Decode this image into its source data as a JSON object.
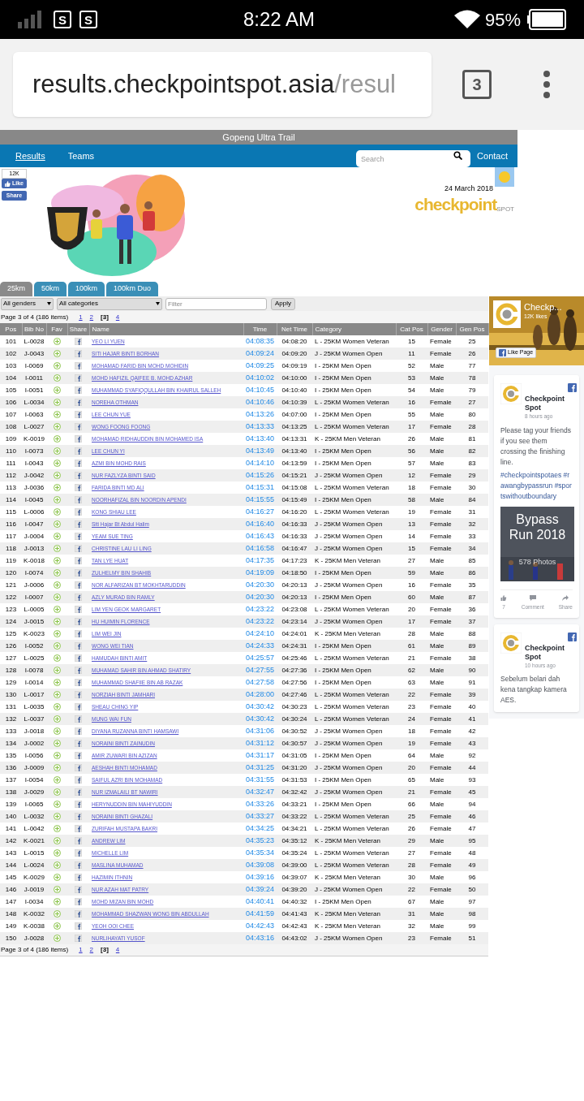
{
  "status_bar": {
    "notifications": [
      "S",
      "S"
    ],
    "time": "8:22 AM",
    "battery": "95%"
  },
  "browser": {
    "url_host": "results.checkpointspot.asia",
    "url_path": "/resul",
    "tab_count": "3"
  },
  "site": {
    "title": "Gopeng Ultra Trail",
    "nav": [
      {
        "label": "Results",
        "selected": true
      },
      {
        "label": "Teams",
        "selected": false
      }
    ],
    "search_placeholder": "Search",
    "contact": "Contact"
  },
  "header": {
    "like_count": "12K",
    "like": "Like",
    "share": "Share",
    "date": "24 March 2018",
    "logo": "checkpoint",
    "logo_sub": "SPOT"
  },
  "distance_tabs": [
    {
      "label": "25km",
      "selected": true
    },
    {
      "label": "50km",
      "selected": false
    },
    {
      "label": "100km",
      "selected": false
    },
    {
      "label": "100km Duo",
      "selected": false
    }
  ],
  "filters": {
    "gender": "All genders",
    "category": "All categories",
    "filter_placeholder": "Filter",
    "apply": "Apply"
  },
  "pager_top": {
    "summary": "Page 3 of 4 (186 items)",
    "pages": [
      {
        "label": "1",
        "selected": false
      },
      {
        "label": "2",
        "selected": false
      },
      {
        "label": "[3]",
        "selected": true
      },
      {
        "label": "4",
        "selected": false
      }
    ]
  },
  "table": {
    "columns": [
      "Pos",
      "Bib No",
      "Fav",
      "Share",
      "Name",
      "Time",
      "Net Time",
      "Category",
      "Cat Pos",
      "Gender",
      "Gen Pos"
    ],
    "rows": [
      [
        "101",
        "L-0028",
        "",
        "",
        "YEO LI YUEN",
        "04:08:35",
        "04:08:20",
        "L - 25KM Women Veteran",
        "15",
        "Female",
        "25"
      ],
      [
        "102",
        "J-0043",
        "",
        "",
        "SITI HAJAR BINTI BORHAN",
        "04:09:24",
        "04:09:20",
        "J - 25KM Women Open",
        "11",
        "Female",
        "26"
      ],
      [
        "103",
        "I-0069",
        "",
        "",
        "MOHAMAD FARID BIN MOHD MOHIDIN",
        "04:09:25",
        "04:09:19",
        "I - 25KM Men Open",
        "52",
        "Male",
        "77"
      ],
      [
        "104",
        "I-0011",
        "",
        "",
        "MOHD HAFIZIL QAIFEE B. MOHD AZHAR",
        "04:10:02",
        "04:10:00",
        "I - 25KM Men Open",
        "53",
        "Male",
        "78"
      ],
      [
        "105",
        "I-0051",
        "",
        "",
        "MUHAMMAD SYAFIQQULLAH BIN KHAIRUL SALLEH",
        "04:10:45",
        "04:10:40",
        "I - 25KM Men Open",
        "54",
        "Male",
        "79"
      ],
      [
        "106",
        "L-0034",
        "",
        "",
        "NOREHA OTHMAN",
        "04:10:46",
        "04:10:39",
        "L - 25KM Women Veteran",
        "16",
        "Female",
        "27"
      ],
      [
        "107",
        "I-0063",
        "",
        "",
        "LEE CHUN YUE",
        "04:13:26",
        "04:07:00",
        "I - 25KM Men Open",
        "55",
        "Male",
        "80"
      ],
      [
        "108",
        "L-0027",
        "",
        "",
        "WONG FOONG FOONG",
        "04:13:33",
        "04:13:25",
        "L - 25KM Women Veteran",
        "17",
        "Female",
        "28"
      ],
      [
        "109",
        "K-0019",
        "",
        "",
        "MOHAMAD RIDHAUDDIN BIN MOHAMED ISA",
        "04:13:40",
        "04:13:31",
        "K - 25KM Men Veteran",
        "26",
        "Male",
        "81"
      ],
      [
        "110",
        "I-0073",
        "",
        "",
        "LEE CHUN YI",
        "04:13:49",
        "04:13:40",
        "I - 25KM Men Open",
        "56",
        "Male",
        "82"
      ],
      [
        "111",
        "I-0043",
        "",
        "",
        "AZMI BIN MOHD RAIS",
        "04:14:10",
        "04:13:59",
        "I - 25KM Men Open",
        "57",
        "Male",
        "83"
      ],
      [
        "112",
        "J-0042",
        "",
        "",
        "NUR FAZLYZA BINTI SAID",
        "04:15:26",
        "04:15:21",
        "J - 25KM Women Open",
        "12",
        "Female",
        "29"
      ],
      [
        "113",
        "J-0036",
        "",
        "",
        "FARIDA BINTI MD ALI",
        "04:15:31",
        "04:15:08",
        "L - 25KM Women Veteran",
        "18",
        "Female",
        "30"
      ],
      [
        "114",
        "I-0045",
        "",
        "",
        "NOORHAFIZAL BIN NOORDIN APENDI",
        "04:15:55",
        "04:15:49",
        "I - 25KM Men Open",
        "58",
        "Male",
        "84"
      ],
      [
        "115",
        "L-0006",
        "",
        "",
        "KONG SHIAU LEE",
        "04:16:27",
        "04:16:20",
        "L - 25KM Women Veteran",
        "19",
        "Female",
        "31"
      ],
      [
        "116",
        "I-0047",
        "",
        "",
        "Siti Hajar Bt Abdul Halim",
        "04:16:40",
        "04:16:33",
        "J - 25KM Women Open",
        "13",
        "Female",
        "32"
      ],
      [
        "117",
        "J-0004",
        "",
        "",
        "YEAM SUE TING",
        "04:16:43",
        "04:16:33",
        "J - 25KM Women Open",
        "14",
        "Female",
        "33"
      ],
      [
        "118",
        "J-0013",
        "",
        "",
        "CHRISTINE LAU LI LING",
        "04:16:58",
        "04:16:47",
        "J - 25KM Women Open",
        "15",
        "Female",
        "34"
      ],
      [
        "119",
        "K-0018",
        "",
        "",
        "TAN LYE HUAT",
        "04:17:35",
        "04:17:23",
        "K - 25KM Men Veteran",
        "27",
        "Male",
        "85"
      ],
      [
        "120",
        "I-0074",
        "",
        "",
        "ZULHELMY BIN SHAHIB",
        "04:19:09",
        "04:18:50",
        "I - 25KM Men Open",
        "59",
        "Male",
        "86"
      ],
      [
        "121",
        "J-0006",
        "",
        "",
        "NOR ALFARIZAN BT MOKHTARUDDIN",
        "04:20:30",
        "04:20:13",
        "J - 25KM Women Open",
        "16",
        "Female",
        "35"
      ],
      [
        "122",
        "I-0007",
        "",
        "",
        "AZLY MURAD BIN RAMLY",
        "04:20:30",
        "04:20:13",
        "I - 25KM Men Open",
        "60",
        "Male",
        "87"
      ],
      [
        "123",
        "L-0005",
        "",
        "",
        "LIM YEN GEOK MARGARET",
        "04:23:22",
        "04:23:08",
        "L - 25KM Women Veteran",
        "20",
        "Female",
        "36"
      ],
      [
        "124",
        "J-0015",
        "",
        "",
        "HU HUIMIN FLORENCE",
        "04:23:22",
        "04:23:14",
        "J - 25KM Women Open",
        "17",
        "Female",
        "37"
      ],
      [
        "125",
        "K-0023",
        "",
        "",
        "LIM WEI JIN",
        "04:24:10",
        "04:24:01",
        "K - 25KM Men Veteran",
        "28",
        "Male",
        "88"
      ],
      [
        "126",
        "I-0052",
        "",
        "",
        "WONG WEI TIAN",
        "04:24:33",
        "04:24:31",
        "I - 25KM Men Open",
        "61",
        "Male",
        "89"
      ],
      [
        "127",
        "L-0025",
        "",
        "",
        "HAMUDAH BINTI AMIT",
        "04:25:57",
        "04:25:46",
        "L - 25KM Women Veteran",
        "21",
        "Female",
        "38"
      ],
      [
        "128",
        "I-0078",
        "",
        "",
        "MUHAMAD SAHIR BIN AHMAD SHATIRY",
        "04:27:55",
        "04:27:36",
        "I - 25KM Men Open",
        "62",
        "Male",
        "90"
      ],
      [
        "129",
        "I-0014",
        "",
        "",
        "MUHAMMAD SHAFIIE BIN AB RAZAK",
        "04:27:58",
        "04:27:56",
        "I - 25KM Men Open",
        "63",
        "Male",
        "91"
      ],
      [
        "130",
        "L-0017",
        "",
        "",
        "NORZIAH BINTI JAMHARI",
        "04:28:00",
        "04:27:46",
        "L - 25KM Women Veteran",
        "22",
        "Female",
        "39"
      ],
      [
        "131",
        "L-0035",
        "",
        "",
        "SHEAU CHING YIP",
        "04:30:42",
        "04:30:23",
        "L - 25KM Women Veteran",
        "23",
        "Female",
        "40"
      ],
      [
        "132",
        "L-0037",
        "",
        "",
        "MUNG WAI FUN",
        "04:30:42",
        "04:30:24",
        "L - 25KM Women Veteran",
        "24",
        "Female",
        "41"
      ],
      [
        "133",
        "J-0018",
        "",
        "",
        "DIYANA RUZANNA BINTI HAMSAWI",
        "04:31:06",
        "04:30:52",
        "J - 25KM Women Open",
        "18",
        "Female",
        "42"
      ],
      [
        "134",
        "J-0002",
        "",
        "",
        "NORAINI BINTI ZAINUDIN",
        "04:31:12",
        "04:30:57",
        "J - 25KM Women Open",
        "19",
        "Female",
        "43"
      ],
      [
        "135",
        "I-0056",
        "",
        "",
        "AMIR ZUWARI BIN AZIZAN",
        "04:31:17",
        "04:31:05",
        "I - 25KM Men Open",
        "64",
        "Male",
        "92"
      ],
      [
        "136",
        "J-0009",
        "",
        "",
        "AESHAH BINTI MOHAMAD",
        "04:31:25",
        "04:31:20",
        "J - 25KM Women Open",
        "20",
        "Female",
        "44"
      ],
      [
        "137",
        "I-0054",
        "",
        "",
        "SAIFUL AZRI BIN MOHAMAD",
        "04:31:55",
        "04:31:53",
        "I - 25KM Men Open",
        "65",
        "Male",
        "93"
      ],
      [
        "138",
        "J-0029",
        "",
        "",
        "NUR IZMALAILI BT NAWIRI",
        "04:32:47",
        "04:32:42",
        "J - 25KM Women Open",
        "21",
        "Female",
        "45"
      ],
      [
        "139",
        "I-0065",
        "",
        "",
        "HERYNUDDIN BIN MAHIYUDDIN",
        "04:33:26",
        "04:33:21",
        "I - 25KM Men Open",
        "66",
        "Male",
        "94"
      ],
      [
        "140",
        "L-0032",
        "",
        "",
        "NORAINI BINTI GHAZALI",
        "04:33:27",
        "04:33:22",
        "L - 25KM Women Veteran",
        "25",
        "Female",
        "46"
      ],
      [
        "141",
        "L-0042",
        "",
        "",
        "ZURIFAH MUSTAPA BAKRI",
        "04:34:25",
        "04:34:21",
        "L - 25KM Women Veteran",
        "26",
        "Female",
        "47"
      ],
      [
        "142",
        "K-0021",
        "",
        "",
        "ANDREW LIM",
        "04:35:23",
        "04:35:12",
        "K - 25KM Men Veteran",
        "29",
        "Male",
        "95"
      ],
      [
        "143",
        "L-0015",
        "",
        "",
        "MICHELLE LIM",
        "04:35:34",
        "04:35:24",
        "L - 25KM Women Veteran",
        "27",
        "Female",
        "48"
      ],
      [
        "144",
        "L-0024",
        "",
        "",
        "MASLINA MUHAMAD",
        "04:39:08",
        "04:39:00",
        "L - 25KM Women Veteran",
        "28",
        "Female",
        "49"
      ],
      [
        "145",
        "K-0029",
        "",
        "",
        "HAZIMIN ITHNIN",
        "04:39:16",
        "04:39:07",
        "K - 25KM Men Veteran",
        "30",
        "Male",
        "96"
      ],
      [
        "146",
        "J-0019",
        "",
        "",
        "NUR AZAH MAT PATRY",
        "04:39:24",
        "04:39:20",
        "J - 25KM Women Open",
        "22",
        "Female",
        "50"
      ],
      [
        "147",
        "I-0034",
        "",
        "",
        "MOHD MIZAN BIN MOHD",
        "04:40:41",
        "04:40:32",
        "I - 25KM Men Open",
        "67",
        "Male",
        "97"
      ],
      [
        "148",
        "K-0032",
        "",
        "",
        "MOHAMMAD SHAZWAN WONG BIN ABDULLAH",
        "04:41:59",
        "04:41:43",
        "K - 25KM Men Veteran",
        "31",
        "Male",
        "98"
      ],
      [
        "149",
        "K-0038",
        "",
        "",
        "YEOH OOI CHEE",
        "04:42:43",
        "04:42:43",
        "K - 25KM Men Veteran",
        "32",
        "Male",
        "99"
      ],
      [
        "150",
        "J-0028",
        "",
        "",
        "NURLIHAYATI YUSOF",
        "04:43:16",
        "04:43:02",
        "J - 25KM Women Open",
        "23",
        "Female",
        "51"
      ]
    ]
  },
  "pager_bottom": {
    "summary": "Page 3 of 4 (186 items)",
    "pages": [
      {
        "label": "1",
        "selected": false
      },
      {
        "label": "2",
        "selected": false
      },
      {
        "label": "[3]",
        "selected": true
      },
      {
        "label": "4",
        "selected": false
      }
    ]
  },
  "facebook": {
    "page_name": "Checkp...",
    "likes": "12K likes",
    "like_button": "Like Page",
    "posts": [
      {
        "author": "Checkpoint Spot",
        "time": "8 hours ago",
        "text": "Please tag your friends if you see them crossing the finishing line.",
        "hashtags": "#checkpointspotaes #rawangbypassrun #sportswithoutboundary",
        "album": {
          "title": "Bypass Run 2018",
          "count": "578 Photos"
        },
        "actions": [
          "7",
          "Comment",
          "Share"
        ]
      },
      {
        "author": "Checkpoint Spot",
        "time": "10 hours ago",
        "text": "Sebelum belari dah kena tangkap kamera AES."
      }
    ]
  }
}
